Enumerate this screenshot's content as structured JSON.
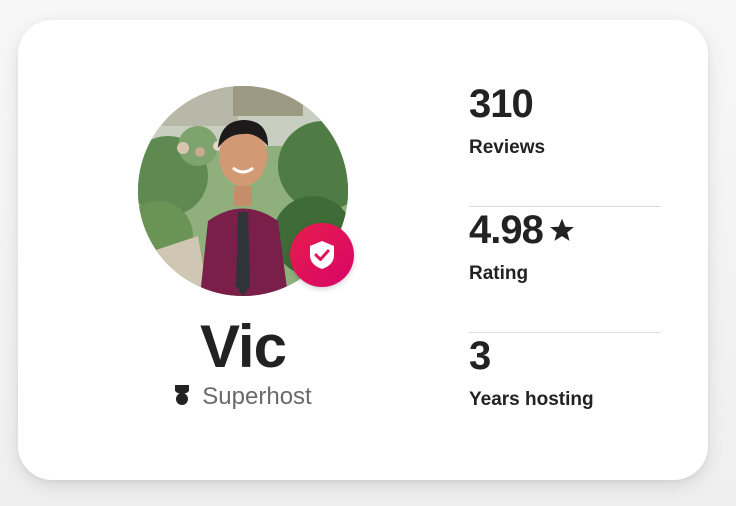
{
  "host": {
    "name": "Vic",
    "badge_label": "Superhost",
    "verified_icon": "verified-shield-icon",
    "superhost_icon": "superhost-medal-icon"
  },
  "stats": [
    {
      "value": "310",
      "label": "Reviews"
    },
    {
      "value": "4.98",
      "label": "Rating",
      "icon": "star-icon"
    },
    {
      "value": "3",
      "label": "Years hosting"
    }
  ],
  "colors": {
    "accent": "#e61e4d",
    "text_primary": "#222222",
    "text_secondary": "#6a6a6a",
    "divider": "#dddddd"
  }
}
